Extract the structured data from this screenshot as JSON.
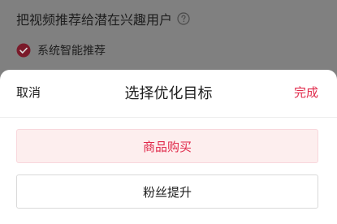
{
  "background": {
    "heading": "把视频推荐给潜在兴趣用户",
    "help_icon": "question-circle-icon",
    "option_label": "系统智能推荐",
    "option_icon": "checkbox-checked-icon"
  },
  "sheet": {
    "cancel_label": "取消",
    "title": "选择优化目标",
    "done_label": "完成",
    "options": [
      {
        "label": "商品购买",
        "selected": true
      },
      {
        "label": "粉丝提升",
        "selected": false
      }
    ]
  },
  "colors": {
    "accent": "#e02a4b",
    "selected_bg": "#fdeeee",
    "overlay": "#808080"
  }
}
